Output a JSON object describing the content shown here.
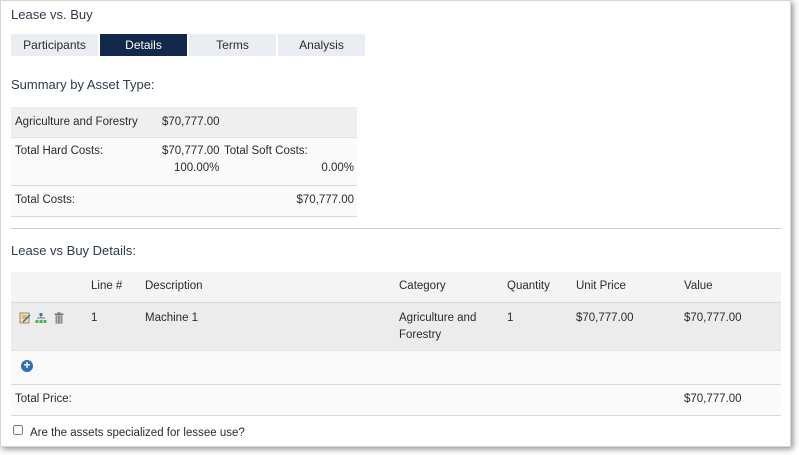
{
  "page": {
    "title": "Lease vs. Buy"
  },
  "tabs": [
    {
      "label": "Participants",
      "active": false
    },
    {
      "label": "Details",
      "active": true
    },
    {
      "label": "Terms",
      "active": false
    },
    {
      "label": "Analysis",
      "active": false
    }
  ],
  "summary": {
    "heading": "Summary by Asset Type:",
    "asset_type": "Agriculture and Forestry",
    "asset_amount": "$70,777.00",
    "hard_label": "Total Hard Costs:",
    "hard_value": "$70,777.00",
    "hard_pct": "100.00%",
    "soft_label": "Total Soft Costs:",
    "soft_pct": "0.00%",
    "total_label": "Total Costs:",
    "total_value": "$70,777.00"
  },
  "details": {
    "heading": "Lease vs Buy Details:",
    "columns": {
      "line": "Line #",
      "description": "Description",
      "category": "Category",
      "quantity": "Quantity",
      "unit_price": "Unit Price",
      "value": "Value"
    },
    "rows": [
      {
        "line": "1",
        "description": "Machine 1",
        "category_line1": "Agriculture and",
        "category_line2": "Forestry",
        "quantity": "1",
        "unit_price": "$70,777.00",
        "value": "$70,777.00"
      }
    ],
    "total_label": "Total Price:",
    "total_value": "$70,777.00"
  },
  "specialized": {
    "label": "Are the assets specialized for lessee use?",
    "checked": false
  },
  "icons": {
    "edit": "edit-icon",
    "hierarchy": "hierarchy-icon",
    "delete": "trash-icon",
    "add": "add-circle-icon"
  },
  "colors": {
    "active_tab": "#12294d",
    "tab": "#eaedf2",
    "add_button": "#2f6db5"
  }
}
